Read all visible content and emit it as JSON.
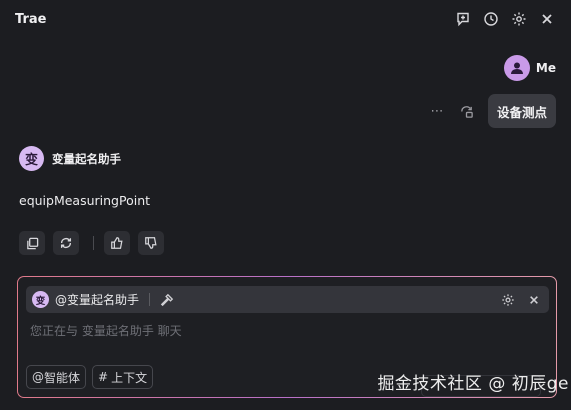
{
  "header": {
    "title": "Trae",
    "icons": [
      "new-chat-icon",
      "history-icon",
      "gear-icon",
      "close-icon"
    ]
  },
  "user": {
    "name": "Me",
    "avatar_icon": "user-icon"
  },
  "user_message": {
    "text": "设备测点"
  },
  "assistant": {
    "avatar_char": "变",
    "name": "变量起名助手",
    "answer": "equipMeasuringPoint"
  },
  "input": {
    "agent_tag_char": "变",
    "agent_tag": "@变量起名助手",
    "placeholder": "您正在与 变量起名助手 聊天",
    "chips": [
      {
        "prefix": "@",
        "label": "智能体"
      },
      {
        "prefix": "#",
        "label": "上下文"
      }
    ]
  },
  "watermark": "掘金技术社区 @ 初辰ge",
  "colors": {
    "background": "#1c1d21",
    "bubble": "#3a3b41",
    "avatar_purple": "#d7b9f2",
    "border_gradient": [
      "#e07a8a",
      "#b870c8",
      "#e49aa8"
    ]
  }
}
